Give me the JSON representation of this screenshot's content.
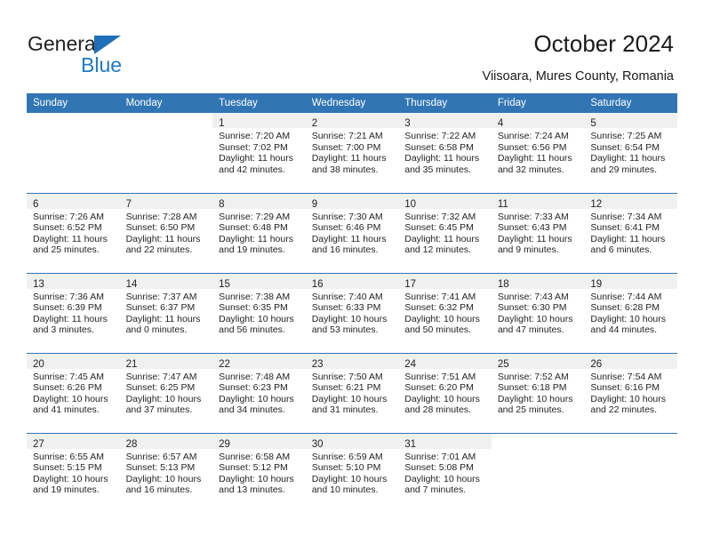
{
  "logo": {
    "word_one": "General",
    "word_two": "Blue",
    "triangle_icon": "triangle-icon",
    "brand_blue": "#1f7ac4"
  },
  "header": {
    "title": "October 2024",
    "subtitle": "Viisoara, Mures County, Romania"
  },
  "calendar": {
    "header_bg": "#3175b4",
    "daynum_band_bg": "#f0f0f0",
    "weekday_headers": [
      "Sunday",
      "Monday",
      "Tuesday",
      "Wednesday",
      "Thursday",
      "Friday",
      "Saturday"
    ],
    "labels": {
      "sunrise": "Sunrise:",
      "sunset": "Sunset:",
      "daylight": "Daylight:"
    },
    "weeks": [
      [
        {
          "day": "",
          "lines": []
        },
        {
          "day": "",
          "lines": []
        },
        {
          "day": "1",
          "lines": [
            "Sunrise: 7:20 AM",
            "Sunset: 7:02 PM",
            "Daylight: 11 hours",
            "and 42 minutes."
          ]
        },
        {
          "day": "2",
          "lines": [
            "Sunrise: 7:21 AM",
            "Sunset: 7:00 PM",
            "Daylight: 11 hours",
            "and 38 minutes."
          ]
        },
        {
          "day": "3",
          "lines": [
            "Sunrise: 7:22 AM",
            "Sunset: 6:58 PM",
            "Daylight: 11 hours",
            "and 35 minutes."
          ]
        },
        {
          "day": "4",
          "lines": [
            "Sunrise: 7:24 AM",
            "Sunset: 6:56 PM",
            "Daylight: 11 hours",
            "and 32 minutes."
          ]
        },
        {
          "day": "5",
          "lines": [
            "Sunrise: 7:25 AM",
            "Sunset: 6:54 PM",
            "Daylight: 11 hours",
            "and 29 minutes."
          ]
        }
      ],
      [
        {
          "day": "6",
          "lines": [
            "Sunrise: 7:26 AM",
            "Sunset: 6:52 PM",
            "Daylight: 11 hours",
            "and 25 minutes."
          ]
        },
        {
          "day": "7",
          "lines": [
            "Sunrise: 7:28 AM",
            "Sunset: 6:50 PM",
            "Daylight: 11 hours",
            "and 22 minutes."
          ]
        },
        {
          "day": "8",
          "lines": [
            "Sunrise: 7:29 AM",
            "Sunset: 6:48 PM",
            "Daylight: 11 hours",
            "and 19 minutes."
          ]
        },
        {
          "day": "9",
          "lines": [
            "Sunrise: 7:30 AM",
            "Sunset: 6:46 PM",
            "Daylight: 11 hours",
            "and 16 minutes."
          ]
        },
        {
          "day": "10",
          "lines": [
            "Sunrise: 7:32 AM",
            "Sunset: 6:45 PM",
            "Daylight: 11 hours",
            "and 12 minutes."
          ]
        },
        {
          "day": "11",
          "lines": [
            "Sunrise: 7:33 AM",
            "Sunset: 6:43 PM",
            "Daylight: 11 hours",
            "and 9 minutes."
          ]
        },
        {
          "day": "12",
          "lines": [
            "Sunrise: 7:34 AM",
            "Sunset: 6:41 PM",
            "Daylight: 11 hours",
            "and 6 minutes."
          ]
        }
      ],
      [
        {
          "day": "13",
          "lines": [
            "Sunrise: 7:36 AM",
            "Sunset: 6:39 PM",
            "Daylight: 11 hours",
            "and 3 minutes."
          ]
        },
        {
          "day": "14",
          "lines": [
            "Sunrise: 7:37 AM",
            "Sunset: 6:37 PM",
            "Daylight: 11 hours",
            "and 0 minutes."
          ]
        },
        {
          "day": "15",
          "lines": [
            "Sunrise: 7:38 AM",
            "Sunset: 6:35 PM",
            "Daylight: 10 hours",
            "and 56 minutes."
          ]
        },
        {
          "day": "16",
          "lines": [
            "Sunrise: 7:40 AM",
            "Sunset: 6:33 PM",
            "Daylight: 10 hours",
            "and 53 minutes."
          ]
        },
        {
          "day": "17",
          "lines": [
            "Sunrise: 7:41 AM",
            "Sunset: 6:32 PM",
            "Daylight: 10 hours",
            "and 50 minutes."
          ]
        },
        {
          "day": "18",
          "lines": [
            "Sunrise: 7:43 AM",
            "Sunset: 6:30 PM",
            "Daylight: 10 hours",
            "and 47 minutes."
          ]
        },
        {
          "day": "19",
          "lines": [
            "Sunrise: 7:44 AM",
            "Sunset: 6:28 PM",
            "Daylight: 10 hours",
            "and 44 minutes."
          ]
        }
      ],
      [
        {
          "day": "20",
          "lines": [
            "Sunrise: 7:45 AM",
            "Sunset: 6:26 PM",
            "Daylight: 10 hours",
            "and 41 minutes."
          ]
        },
        {
          "day": "21",
          "lines": [
            "Sunrise: 7:47 AM",
            "Sunset: 6:25 PM",
            "Daylight: 10 hours",
            "and 37 minutes."
          ]
        },
        {
          "day": "22",
          "lines": [
            "Sunrise: 7:48 AM",
            "Sunset: 6:23 PM",
            "Daylight: 10 hours",
            "and 34 minutes."
          ]
        },
        {
          "day": "23",
          "lines": [
            "Sunrise: 7:50 AM",
            "Sunset: 6:21 PM",
            "Daylight: 10 hours",
            "and 31 minutes."
          ]
        },
        {
          "day": "24",
          "lines": [
            "Sunrise: 7:51 AM",
            "Sunset: 6:20 PM",
            "Daylight: 10 hours",
            "and 28 minutes."
          ]
        },
        {
          "day": "25",
          "lines": [
            "Sunrise: 7:52 AM",
            "Sunset: 6:18 PM",
            "Daylight: 10 hours",
            "and 25 minutes."
          ]
        },
        {
          "day": "26",
          "lines": [
            "Sunrise: 7:54 AM",
            "Sunset: 6:16 PM",
            "Daylight: 10 hours",
            "and 22 minutes."
          ]
        }
      ],
      [
        {
          "day": "27",
          "lines": [
            "Sunrise: 6:55 AM",
            "Sunset: 5:15 PM",
            "Daylight: 10 hours",
            "and 19 minutes."
          ]
        },
        {
          "day": "28",
          "lines": [
            "Sunrise: 6:57 AM",
            "Sunset: 5:13 PM",
            "Daylight: 10 hours",
            "and 16 minutes."
          ]
        },
        {
          "day": "29",
          "lines": [
            "Sunrise: 6:58 AM",
            "Sunset: 5:12 PM",
            "Daylight: 10 hours",
            "and 13 minutes."
          ]
        },
        {
          "day": "30",
          "lines": [
            "Sunrise: 6:59 AM",
            "Sunset: 5:10 PM",
            "Daylight: 10 hours",
            "and 10 minutes."
          ]
        },
        {
          "day": "31",
          "lines": [
            "Sunrise: 7:01 AM",
            "Sunset: 5:08 PM",
            "Daylight: 10 hours",
            "and 7 minutes."
          ]
        },
        {
          "day": "",
          "lines": []
        },
        {
          "day": "",
          "lines": []
        }
      ]
    ]
  }
}
